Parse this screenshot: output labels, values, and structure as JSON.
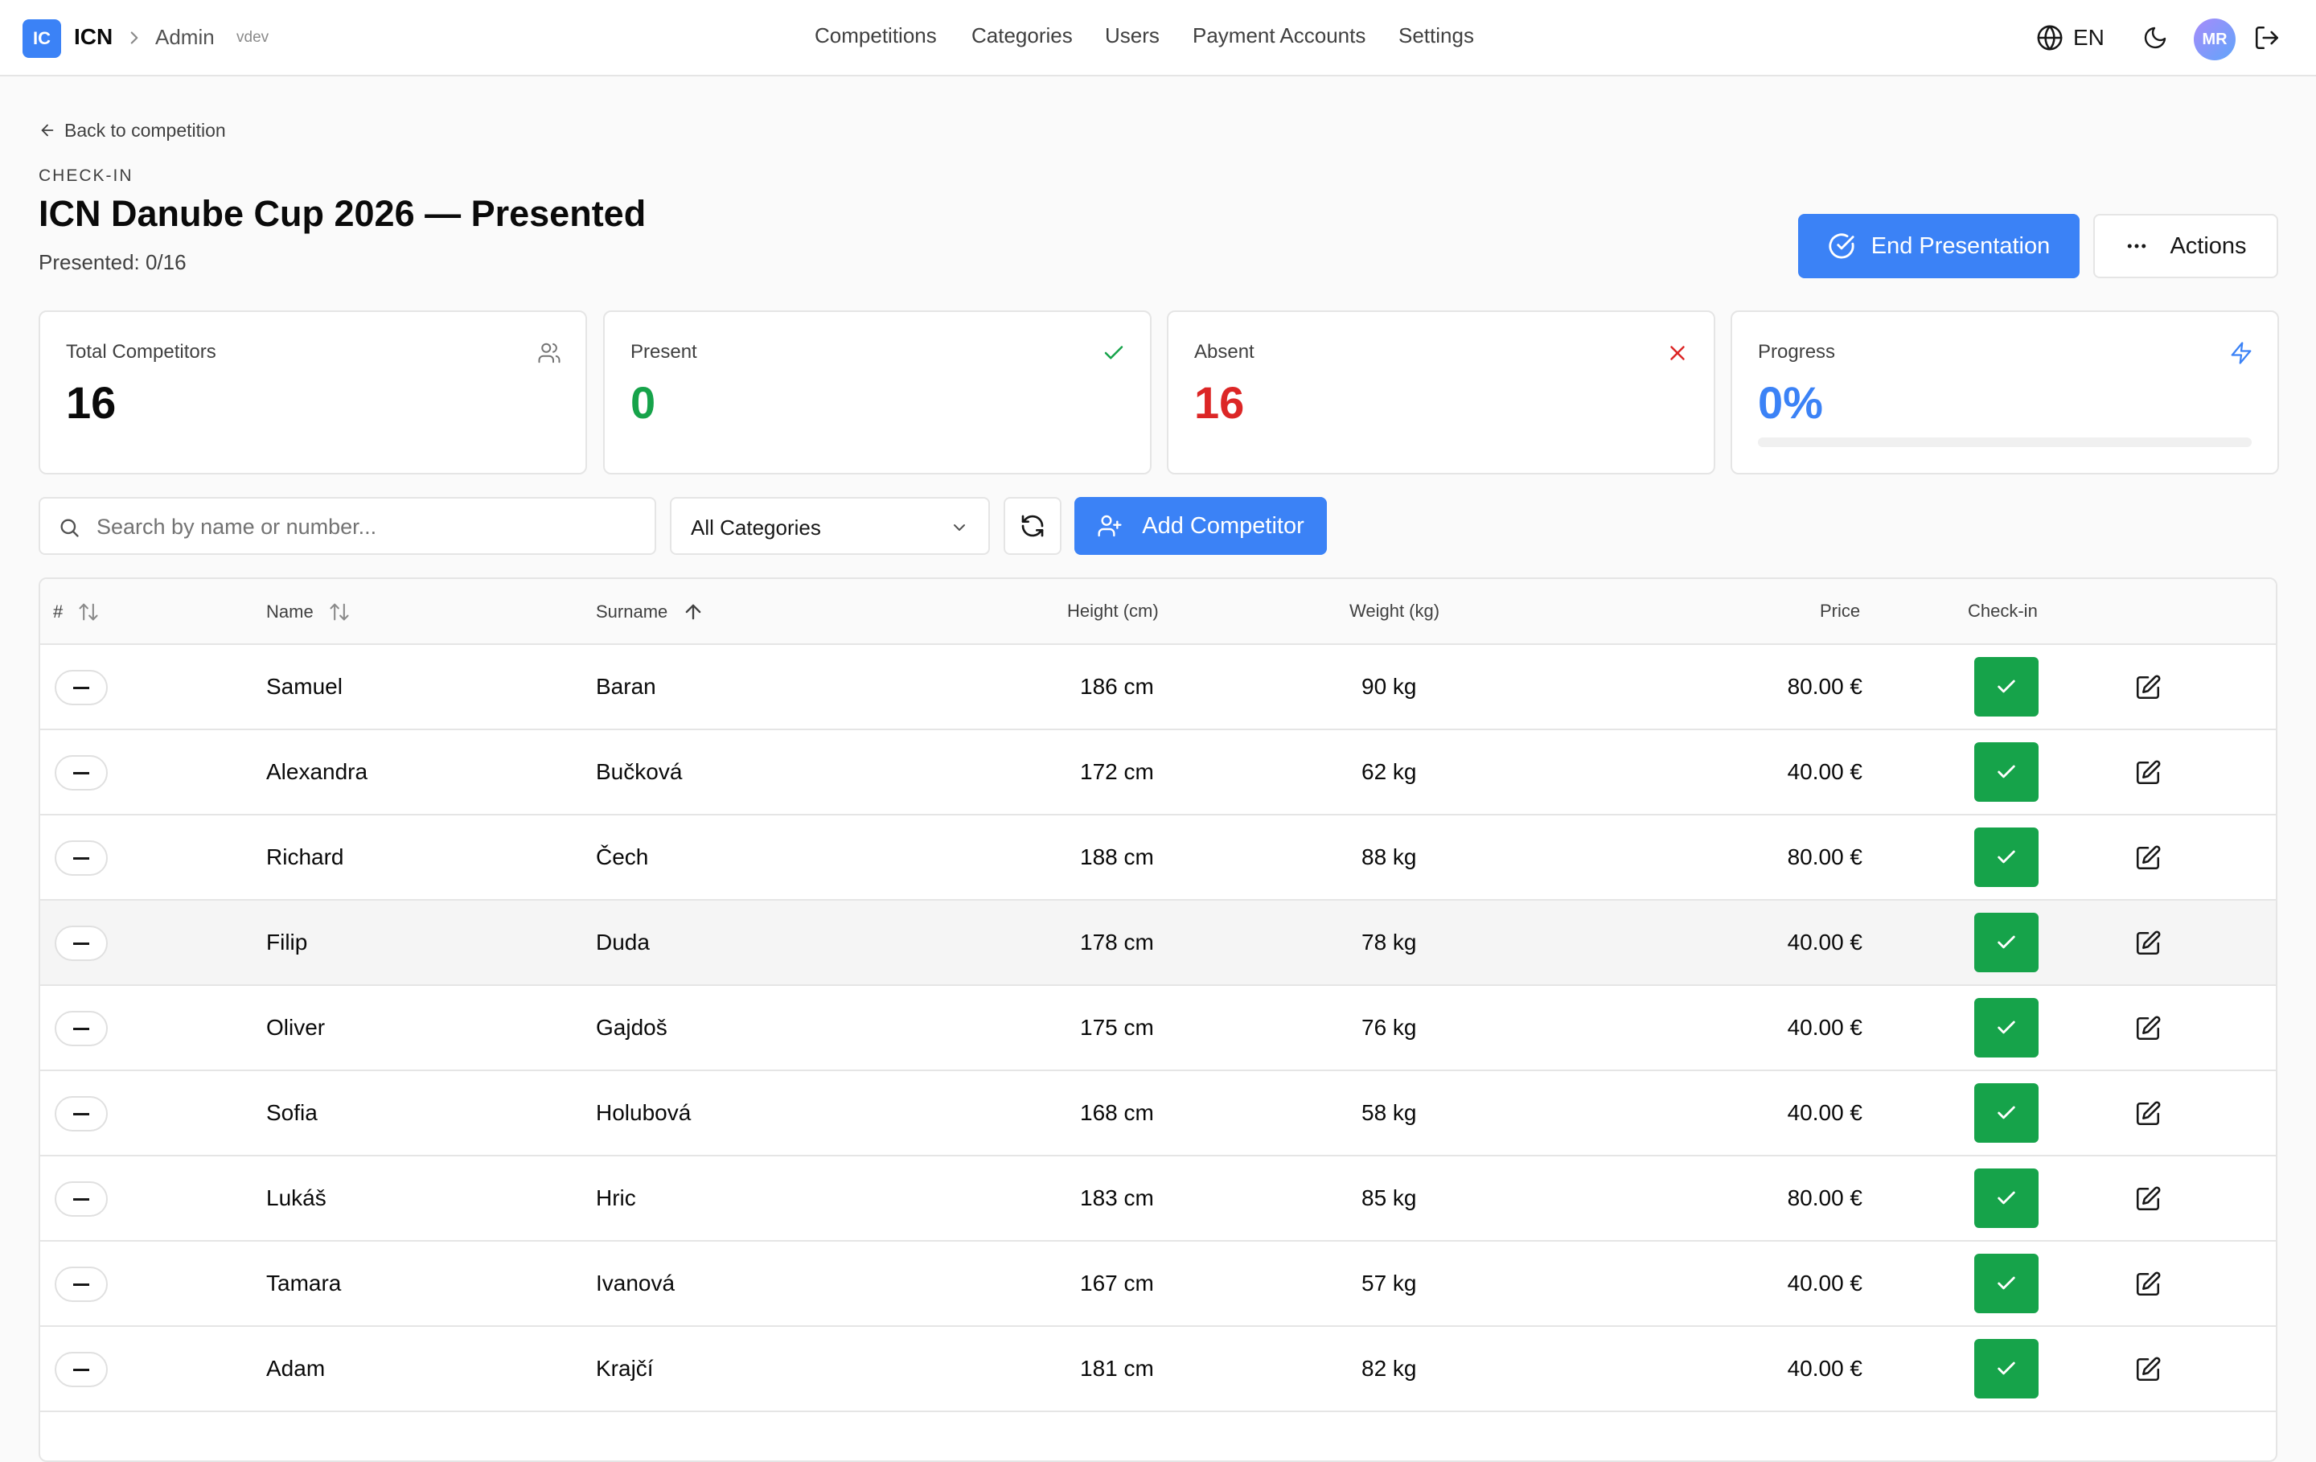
{
  "app": {
    "badge": "IC",
    "name": "ICN",
    "breadcrumb": "Admin",
    "version": "vdev",
    "avatar_initials": "MR",
    "language": "EN"
  },
  "nav": [
    "Competitions",
    "Categories",
    "Users",
    "Payment Accounts",
    "Settings"
  ],
  "header": {
    "back_label": "Back to competition",
    "eyebrow": "CHECK-IN",
    "title": "ICN Danube Cup 2026 — Presented",
    "subtitle": "Presented: 0/16",
    "end_presentation_label": "End Presentation",
    "actions_label": "Actions"
  },
  "stats": {
    "total": {
      "label": "Total Competitors",
      "value": "16",
      "icon": "users-icon",
      "color": "#0a0a0a"
    },
    "present": {
      "label": "Present",
      "value": "0",
      "icon": "check-icon",
      "color": "#16a34a"
    },
    "absent": {
      "label": "Absent",
      "value": "16",
      "icon": "x-icon",
      "color": "#dc2626"
    },
    "progress": {
      "label": "Progress",
      "value": "0%",
      "icon": "zap-icon",
      "color": "#3b82f6",
      "fraction": 0
    }
  },
  "toolbar": {
    "search_placeholder": "Search by name or number...",
    "category_selected": "All Categories",
    "add_label": "Add Competitor"
  },
  "table": {
    "headers": {
      "num": "#",
      "name": "Name",
      "surname": "Surname",
      "height": "Height (cm)",
      "weight": "Weight (kg)",
      "price": "Price",
      "checkin": "Check-in"
    },
    "rows": [
      {
        "name": "Samuel",
        "surname": "Baran",
        "height": "186 cm",
        "weight": "90 kg",
        "price": "80.00 €"
      },
      {
        "name": "Alexandra",
        "surname": "Bučková",
        "height": "172 cm",
        "weight": "62 kg",
        "price": "40.00 €"
      },
      {
        "name": "Richard",
        "surname": "Čech",
        "height": "188 cm",
        "weight": "88 kg",
        "price": "80.00 €"
      },
      {
        "name": "Filip",
        "surname": "Duda",
        "height": "178 cm",
        "weight": "78 kg",
        "price": "40.00 €"
      },
      {
        "name": "Oliver",
        "surname": "Gajdoš",
        "height": "175 cm",
        "weight": "76 kg",
        "price": "40.00 €"
      },
      {
        "name": "Sofia",
        "surname": "Holubová",
        "height": "168 cm",
        "weight": "58 kg",
        "price": "40.00 €"
      },
      {
        "name": "Lukáš",
        "surname": "Hric",
        "height": "183 cm",
        "weight": "85 kg",
        "price": "80.00 €"
      },
      {
        "name": "Tamara",
        "surname": "Ivanová",
        "height": "167 cm",
        "weight": "57 kg",
        "price": "40.00 €"
      },
      {
        "name": "Adam",
        "surname": "Krajčí",
        "height": "181 cm",
        "weight": "82 kg",
        "price": "40.00 €"
      }
    ],
    "highlighted_row": 3
  },
  "colors": {
    "accent": "#3b82f6",
    "success": "#16a34a",
    "danger": "#dc2626"
  }
}
